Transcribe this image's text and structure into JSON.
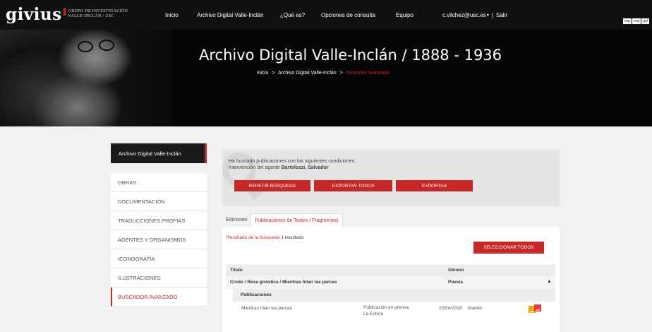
{
  "header": {
    "logo_text": "givius",
    "logo_sub_line1": "GRUPO DE INVESTIGACIÓN",
    "logo_sub_line2": "VALLE-INCLÁN / USC",
    "nav": [
      "Inicio",
      "Archivo Digital Valle-Inclán",
      "¿Qué es?",
      "Opciones de consulta",
      "Equipo"
    ],
    "user": "c.vilchez@usc.es",
    "user_caret": "▾",
    "separator": "|",
    "logout": "Salir",
    "languages": [
      "esp",
      "eng",
      "gal"
    ]
  },
  "hero": {
    "title": "Archivo Digital Valle-Inclán / 1888 - 1936",
    "breadcrumb": [
      "Inicio",
      ">",
      "Archivo Digital Valle-Inclán",
      ">",
      "Buscador avanzado"
    ]
  },
  "sidebar": {
    "heading": "Archivo Digital Valle-Inclán",
    "items": [
      {
        "label": "OBRAS"
      },
      {
        "label": "DOCUMENTACIÓN"
      },
      {
        "label": "TRADUCCIONES PROPIAS"
      },
      {
        "label": "AGENTES Y ORGANISMOS"
      },
      {
        "label": "ICONOGRAFÍA"
      },
      {
        "label": "ILUSTRACIONES"
      },
      {
        "label": "BUSCADOR AVANZADO",
        "active": true
      }
    ]
  },
  "search": {
    "intro": "Ha buscado publicaciones con las siguientes condiciones:",
    "condition_prefix": "Intervención del agente ",
    "condition_value": "Bartolozzi, Salvador",
    "buttons": [
      "REPETIR BÚSQUEDA",
      "EXPORTAR TODOS",
      "EXPORTAR"
    ]
  },
  "tabs": [
    {
      "label": "Ediciones",
      "active": false
    },
    {
      "label": "Publicaciones de Textos / Fragmentos",
      "active": true
    }
  ],
  "results": {
    "label": "Resultado de la búsqueda",
    "count_text": "1 resultado",
    "select_all": "SELECCIONAR TODOS",
    "columns": [
      "Título",
      "Género"
    ],
    "rows": [
      {
        "title": "Credo / Rosa gnóstica / Mientras hilan las parcas",
        "genre": "Poesía",
        "expanded_icon": "▲",
        "sub_heading": "Publicaciones",
        "publications": [
          {
            "title": "Mientras hilan las parcas",
            "type_line1": "Publicación en prensa:",
            "type_line2": "La Esfera",
            "date": "22/04/1916",
            "place": "Madrid",
            "icons": [
              "jpg-file-icon",
              "pdf-file-icon"
            ]
          }
        ]
      }
    ]
  },
  "colors": {
    "accent": "#c62828",
    "topbar": "#111111",
    "background": "#f1f1f1"
  }
}
